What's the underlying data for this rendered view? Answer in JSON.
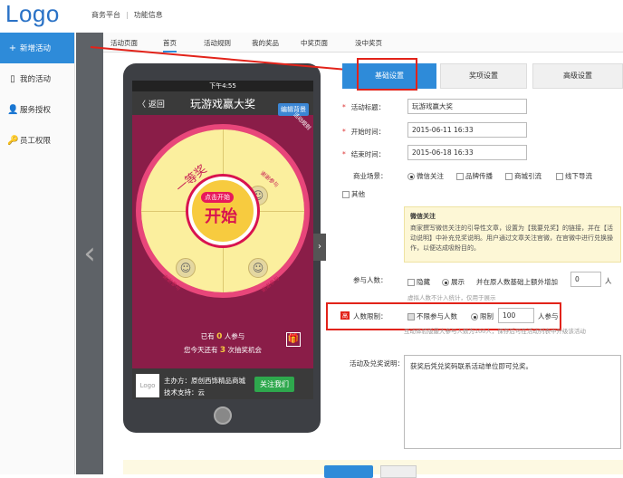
{
  "logo": "Logo",
  "topnav": {
    "item1": "商务平台",
    "item2": "功能信息"
  },
  "sidebar": {
    "items": [
      {
        "icon": "+",
        "label": "新增活动"
      },
      {
        "icon": "▯",
        "label": "我的活动"
      },
      {
        "icon": "👤",
        "label": "服务授权"
      },
      {
        "icon": "🔑",
        "label": "员工权限"
      }
    ]
  },
  "subnav": [
    "活动页面",
    "首页",
    "活动规则",
    "我的奖品",
    "中奖页面",
    "没中奖页"
  ],
  "phone": {
    "status_time": "下午4:55",
    "back": "〈 返回",
    "title": "玩游戏赢大奖",
    "edit_bg": "编辑背景",
    "rules": "活动规则",
    "prize": "一等奖",
    "thanks": "谢谢参与",
    "click_start": "点击开始",
    "start": "开始",
    "joined_prefix": "已有",
    "joined_count": "0",
    "joined_suffix": "人参与",
    "chances_prefix": "您今天还有",
    "chances_count": "3",
    "chances_suffix": "次抽奖机会",
    "footer_logo": "Logo",
    "sponsor": "主办方：原创西饰精品商城",
    "support": "技术支持：云",
    "follow": "关注我们"
  },
  "tabs": [
    "基础设置",
    "奖项设置",
    "高级设置"
  ],
  "form": {
    "title_label": "活动标题：",
    "title_value": "玩游戏赢大奖",
    "start_label": "开始时间：",
    "start_value": "2015-06-11 16:33",
    "end_label": "结束时间：",
    "end_value": "2015-06-18 16:33",
    "scene_label": "商业场景：",
    "scene_options": [
      "微信关注",
      "品牌传播",
      "商城引流",
      "线下导流"
    ],
    "other": "其他",
    "note_title": "微信关注",
    "note_text": "商家撰写微信关注的引导性文章，设置为【我要兑奖】的链接，并在【活动说明】中补充兑奖说明。用户通过文章关注官微，在官微中进行兑换操作，以便达成吸粉目的。",
    "participants_label": "参与人数：",
    "hide": "隐藏",
    "show": "展示",
    "extra_text": "并在原人数基础上额外增加",
    "extra_value": "0",
    "person_unit": "人",
    "participants_hint": "虚拟人数不计入统计，仅用于展示",
    "limit_tag": "高",
    "limit_label": "人数限制：",
    "unlimited": "不限参与人数",
    "limited": "限制",
    "limit_value": "100",
    "limit_unit": "人参与",
    "limit_hint": "互动体验版最大参与人数为100人，保存后可在活动列表中升级该活动",
    "desc_label": "活动及兑奖说明：",
    "desc_value": "获奖后凭兑奖码联系活动单位即可兑奖。"
  },
  "colors": {
    "accent": "#2e8bd9",
    "highlight": "#e2231a",
    "wheel": "#d0134e"
  }
}
